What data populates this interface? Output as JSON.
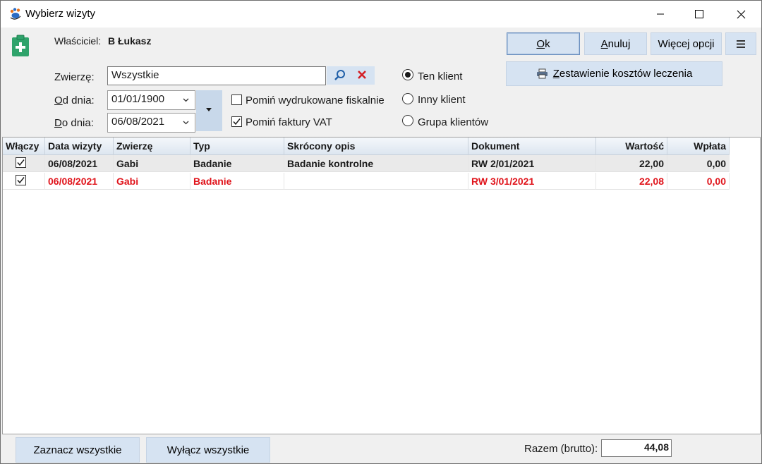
{
  "window": {
    "title": "Wybierz wizyty"
  },
  "header": {
    "owner_label": "Właściciel:",
    "owner_value": "B Łukasz"
  },
  "filters": {
    "animal_label_pre": "Zwierzę:",
    "animal_value": "Wszystkie",
    "from_label_u": "O",
    "from_label_rest": "d dnia:",
    "from_value": "01/01/1900",
    "to_label_u": "D",
    "to_label_rest": "o dnia:",
    "to_value": "06/08/2021",
    "skip_fiscal_label": "Pomiń wydrukowane fiskalnie",
    "skip_fiscal_checked": false,
    "skip_vat_label": "Pomiń faktury VAT",
    "skip_vat_checked": true
  },
  "client_scope": {
    "options": [
      "Ten klient",
      "Inny klient",
      "Grupa klientów"
    ],
    "selected": "Ten klient"
  },
  "buttons": {
    "ok_u": "O",
    "ok_rest": "k",
    "cancel_u": "A",
    "cancel_rest": "nuluj",
    "more_options": "Więcej opcji",
    "cost_summary_u": "Z",
    "cost_summary_rest": "estawienie kosztów leczenia",
    "select_all": "Zaznacz wszystkie",
    "deselect_all": "Wyłącz wszystkie"
  },
  "table": {
    "columns": [
      "Włączy",
      "Data wizyty",
      "Zwierzę",
      "Typ",
      "Skrócony opis",
      "Dokument",
      "Wartość",
      "Wpłata"
    ],
    "rows": [
      {
        "checked": true,
        "date": "06/08/2021",
        "animal": "Gabi",
        "type": "Badanie",
        "description": "Badanie kontrolne",
        "document": "RW 2/01/2021",
        "value": "22,00",
        "payment": "0,00",
        "color": "#1a1a1a"
      },
      {
        "checked": true,
        "date": "06/08/2021",
        "animal": "Gabi",
        "type": "Badanie",
        "description": "",
        "document": "RW 3/01/2021",
        "value": "22,08",
        "payment": "0,00",
        "color": "#e0141b"
      }
    ]
  },
  "footer": {
    "total_label": "Razem (brutto):",
    "total_value": "44,08"
  },
  "colors": {
    "button_bg": "#d6e3f2",
    "highlight_red": "#e0141b",
    "clipboard_green": "#2fa36b"
  }
}
